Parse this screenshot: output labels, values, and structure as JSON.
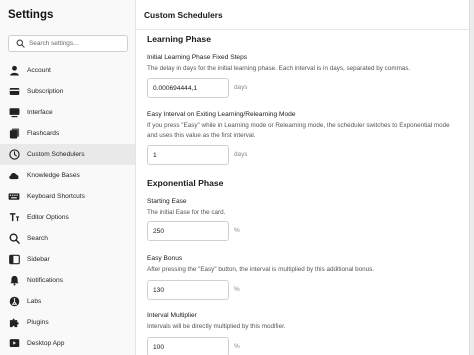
{
  "sidebar": {
    "title": "Settings",
    "search_placeholder": "Search settings...",
    "items": [
      {
        "label": "Account",
        "icon": "user-icon"
      },
      {
        "label": "Subscription",
        "icon": "card-icon"
      },
      {
        "label": "Interface",
        "icon": "monitor-icon"
      },
      {
        "label": "Flashcards",
        "icon": "flashcards-icon"
      },
      {
        "label": "Custom Schedulers",
        "icon": "clock-icon"
      },
      {
        "label": "Knowledge Bases",
        "icon": "cloud-icon"
      },
      {
        "label": "Keyboard Shortcuts",
        "icon": "keyboard-icon"
      },
      {
        "label": "Editor Options",
        "icon": "text-format-icon"
      },
      {
        "label": "Search",
        "icon": "search-icon"
      },
      {
        "label": "Sidebar",
        "icon": "sidebar-icon"
      },
      {
        "label": "Notifications",
        "icon": "bell-icon"
      },
      {
        "label": "Labs",
        "icon": "labs-icon"
      },
      {
        "label": "Plugins",
        "icon": "puzzle-icon"
      },
      {
        "label": "Desktop App",
        "icon": "desktop-app-icon"
      }
    ],
    "active_item": "Custom Schedulers"
  },
  "main": {
    "title": "Custom Schedulers",
    "learning_phase": {
      "section_title": "Learning Phase",
      "fixed_steps": {
        "label": "Initial Learning Phase Fixed Steps",
        "description": "The delay in days for the initial learning phase. Each interval is in days, separated by commas.",
        "value": "0.000694444,1",
        "unit": "days"
      },
      "exit_interval": {
        "label": "Easy Interval on Exiting Learning/Relearning Mode",
        "description": "If you press \"Easy\" while in Learning mode or Relearning mode, the scheduler switches to Exponential mode and uses this value as the first interval.",
        "value": "1",
        "unit": "days"
      }
    },
    "exponential_phase": {
      "section_title": "Exponential Phase",
      "starting_ease": {
        "label": "Starting Ease",
        "description": "The initial Ease for the card.",
        "value": "250",
        "unit": "%"
      },
      "easy_bonus": {
        "label": "Easy Bonus",
        "description": "After pressing the \"Easy\" button, the interval is multiplied by this additional bonus.",
        "value": "130",
        "unit": "%"
      },
      "interval_multiplier": {
        "label": "Interval Multiplier",
        "description": "Intervals will be directly multiplied by this modifier.",
        "value": "100",
        "unit": "%"
      }
    }
  }
}
